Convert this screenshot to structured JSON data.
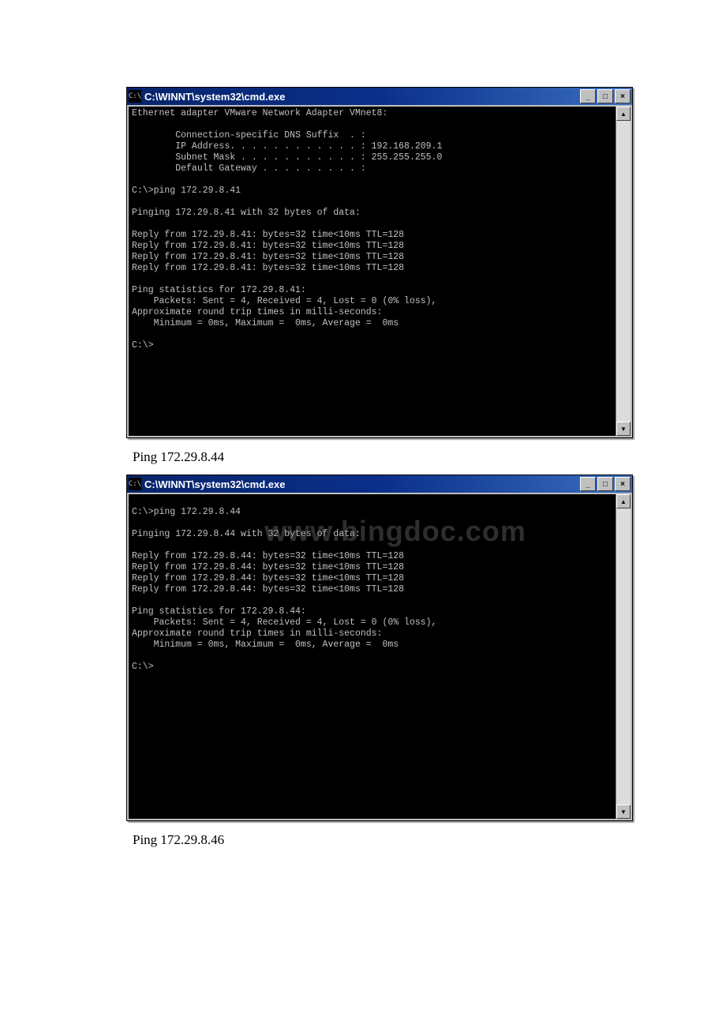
{
  "window1": {
    "title": "C:\\WINNT\\system32\\cmd.exe",
    "sysicon": "C:\\",
    "content": "Ethernet adapter VMware Network Adapter VMnet8:\n\n        Connection-specific DNS Suffix  . :\n        IP Address. . . . . . . . . . . . : 192.168.209.1\n        Subnet Mask . . . . . . . . . . . : 255.255.255.0\n        Default Gateway . . . . . . . . . :\n\nC:\\>ping 172.29.8.41\n\nPinging 172.29.8.41 with 32 bytes of data:\n\nReply from 172.29.8.41: bytes=32 time<10ms TTL=128\nReply from 172.29.8.41: bytes=32 time<10ms TTL=128\nReply from 172.29.8.41: bytes=32 time<10ms TTL=128\nReply from 172.29.8.41: bytes=32 time<10ms TTL=128\n\nPing statistics for 172.29.8.41:\n    Packets: Sent = 4, Received = 4, Lost = 0 (0% loss),\nApproximate round trip times in milli-seconds:\n    Minimum = 0ms, Maximum =  0ms, Average =  0ms\n\nC:\\>"
  },
  "caption1": "Ping 172.29.8.44",
  "window2": {
    "title": "C:\\WINNT\\system32\\cmd.exe",
    "sysicon": "C:\\",
    "content": "\nC:\\>ping 172.29.8.44\n\nPinging 172.29.8.44 with 32 bytes of data:\n\nReply from 172.29.8.44: bytes=32 time<10ms TTL=128\nReply from 172.29.8.44: bytes=32 time<10ms TTL=128\nReply from 172.29.8.44: bytes=32 time<10ms TTL=128\nReply from 172.29.8.44: bytes=32 time<10ms TTL=128\n\nPing statistics for 172.29.8.44:\n    Packets: Sent = 4, Received = 4, Lost = 0 (0% loss),\nApproximate round trip times in milli-seconds:\n    Minimum = 0ms, Maximum =  0ms, Average =  0ms\n\nC:\\>"
  },
  "watermark": "www.bingdoc.com",
  "caption2": "Ping 172.29.8.46",
  "buttons": {
    "minimize": "_",
    "maximize": "□",
    "close": "×",
    "up": "▲",
    "down": "▼"
  }
}
